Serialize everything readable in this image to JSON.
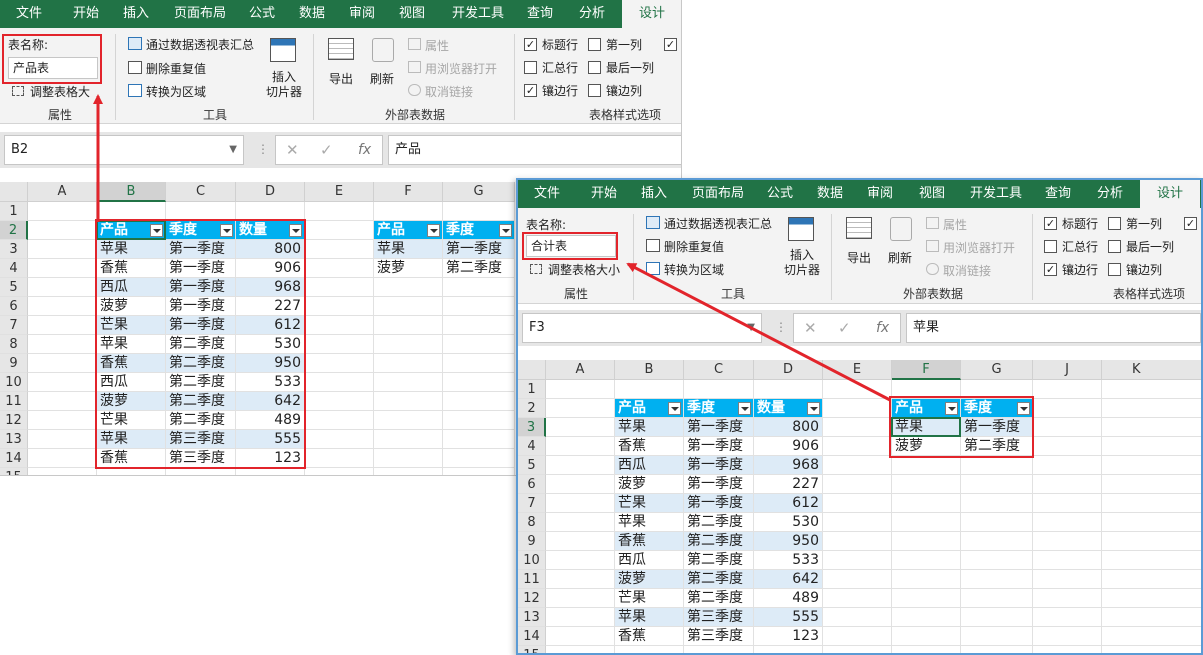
{
  "ribbon": {
    "tabs": [
      "文件",
      "开始",
      "插入",
      "页面布局",
      "公式",
      "数据",
      "审阅",
      "视图",
      "开发工具",
      "查询",
      "分析",
      "设计"
    ],
    "active_tab": "设计",
    "properties": {
      "name_label": "表名称:",
      "resize": "调整表格大小",
      "group": "属性"
    },
    "tools": {
      "pivot": "通过数据透视表汇总",
      "remove_dup": "删除重复值",
      "convert": "转换为区域",
      "slicer_line1": "插入",
      "slicer_line2": "切片器",
      "group": "工具"
    },
    "external": {
      "export": "导出",
      "refresh": "刷新",
      "props": "属性",
      "browser": "用浏览器打开",
      "unlink": "取消链接",
      "group": "外部表数据"
    },
    "style_options": {
      "header_row": "标题行",
      "total_row": "汇总行",
      "banded_rows": "镶边行",
      "first_col": "第一列",
      "last_col": "最后一列",
      "banded_cols": "镶边列",
      "group": "表格样式选项"
    },
    "fx": "fx"
  },
  "win1": {
    "table_name": "产品表",
    "name_box": "B2",
    "formula": "产品",
    "resize_label": "调整表格大",
    "col_headers": [
      "A",
      "B",
      "C",
      "D",
      "E",
      "F",
      "G"
    ]
  },
  "win2": {
    "table_name": "合计表",
    "name_box": "F3",
    "formula": "苹果",
    "resize_label": "调整表格大小",
    "col_headers": [
      "A",
      "B",
      "C",
      "D",
      "E",
      "F",
      "G",
      "J",
      "K"
    ]
  },
  "row_numbers": [
    "1",
    "2",
    "3",
    "4",
    "5",
    "6",
    "7",
    "8",
    "9",
    "10",
    "11",
    "12",
    "13",
    "14",
    "15"
  ],
  "table1": {
    "headers": [
      "产品",
      "季度",
      "数量"
    ],
    "rows": [
      [
        "苹果",
        "第一季度",
        "800"
      ],
      [
        "香蕉",
        "第一季度",
        "906"
      ],
      [
        "西瓜",
        "第一季度",
        "968"
      ],
      [
        "菠萝",
        "第一季度",
        "227"
      ],
      [
        "芒果",
        "第一季度",
        "612"
      ],
      [
        "苹果",
        "第二季度",
        "530"
      ],
      [
        "香蕉",
        "第二季度",
        "950"
      ],
      [
        "西瓜",
        "第二季度",
        "533"
      ],
      [
        "菠萝",
        "第二季度",
        "642"
      ],
      [
        "芒果",
        "第二季度",
        "489"
      ],
      [
        "苹果",
        "第三季度",
        "555"
      ],
      [
        "香蕉",
        "第三季度",
        "123"
      ]
    ]
  },
  "table2": {
    "headers": [
      "产品",
      "季度"
    ],
    "rows": [
      [
        "苹果",
        "第一季度"
      ],
      [
        "菠萝",
        "第二季度"
      ]
    ]
  },
  "colors": {
    "accent": "#217346",
    "table_header": "#00b0f0",
    "band": "#ddebf7",
    "highlight": "#e2242b"
  }
}
